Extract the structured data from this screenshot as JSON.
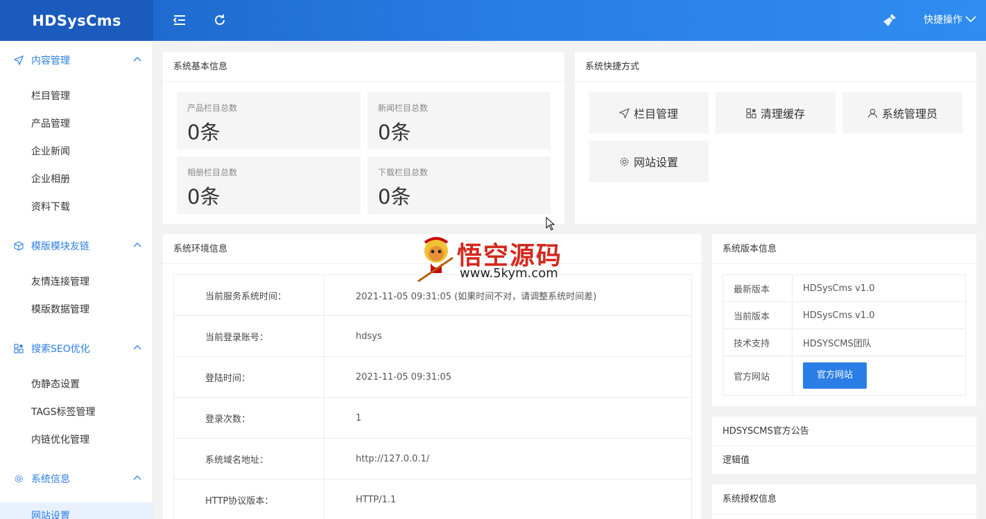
{
  "app": {
    "logo": "HDSysCms"
  },
  "topbar": {
    "quick_ops": "快捷操作"
  },
  "sidebar": {
    "groups": [
      {
        "label": "内容管理",
        "icon": "paper-plane-icon",
        "items": [
          "栏目管理",
          "产品管理",
          "企业新闻",
          "企业相册",
          "资料下载"
        ]
      },
      {
        "label": "模版模块友链",
        "icon": "cube-icon",
        "items": [
          "友情连接管理",
          "模版数据管理"
        ]
      },
      {
        "label": "搜索SEO优化",
        "icon": "grid-icon",
        "items": [
          "伪静态设置",
          "TAGS标签管理",
          "内链优化管理"
        ]
      },
      {
        "label": "系统信息",
        "icon": "gear-icon",
        "items": [
          "网站设置"
        ]
      }
    ]
  },
  "basic_info": {
    "title": "系统基本信息",
    "stats": [
      {
        "label": "产品栏目总数",
        "value": "0条"
      },
      {
        "label": "新闻栏目总数",
        "value": "0条"
      },
      {
        "label": "相册栏目总数",
        "value": "0条"
      },
      {
        "label": "下载栏目总数",
        "value": "0条"
      }
    ]
  },
  "shortcuts": {
    "title": "系统快捷方式",
    "items": [
      {
        "label": "栏目管理",
        "icon": "paper-plane-icon"
      },
      {
        "label": "清理缓存",
        "icon": "grid-icon"
      },
      {
        "label": "系统管理员",
        "icon": "user-icon"
      },
      {
        "label": "网站设置",
        "icon": "gear-icon"
      }
    ]
  },
  "env_info": {
    "title": "系统环境信息",
    "rows": [
      {
        "k": "当前服务系统时间：",
        "v": "2021-11-05 09:31:05 (如果时间不对，请调整系统时间差)"
      },
      {
        "k": "当前登录账号：",
        "v": "hdsys"
      },
      {
        "k": "登陆时间：",
        "v": "2021-11-05 09:31:05"
      },
      {
        "k": "登录次数：",
        "v": "1"
      },
      {
        "k": "系统域名地址：",
        "v": "http://127.0.0.1/"
      },
      {
        "k": "HTTP协议版本：",
        "v": "HTTP/1.1"
      }
    ]
  },
  "version_info": {
    "title": "系统版本信息",
    "rows": [
      {
        "k": "最新版本",
        "v": "HDSysCms v1.0"
      },
      {
        "k": "当前版本",
        "v": "HDSysCms v1.0"
      },
      {
        "k": "技术支持",
        "v": "HDSYSCMS团队"
      }
    ],
    "official_label": "官方网站",
    "official_button": "官方网站"
  },
  "announcement": {
    "title": "HDSYSCMS官方公告",
    "content": "逻辑值"
  },
  "license": {
    "title": "系统授权信息"
  },
  "watermark": {
    "title": "悟空源码",
    "url": "www.5kym.com"
  }
}
